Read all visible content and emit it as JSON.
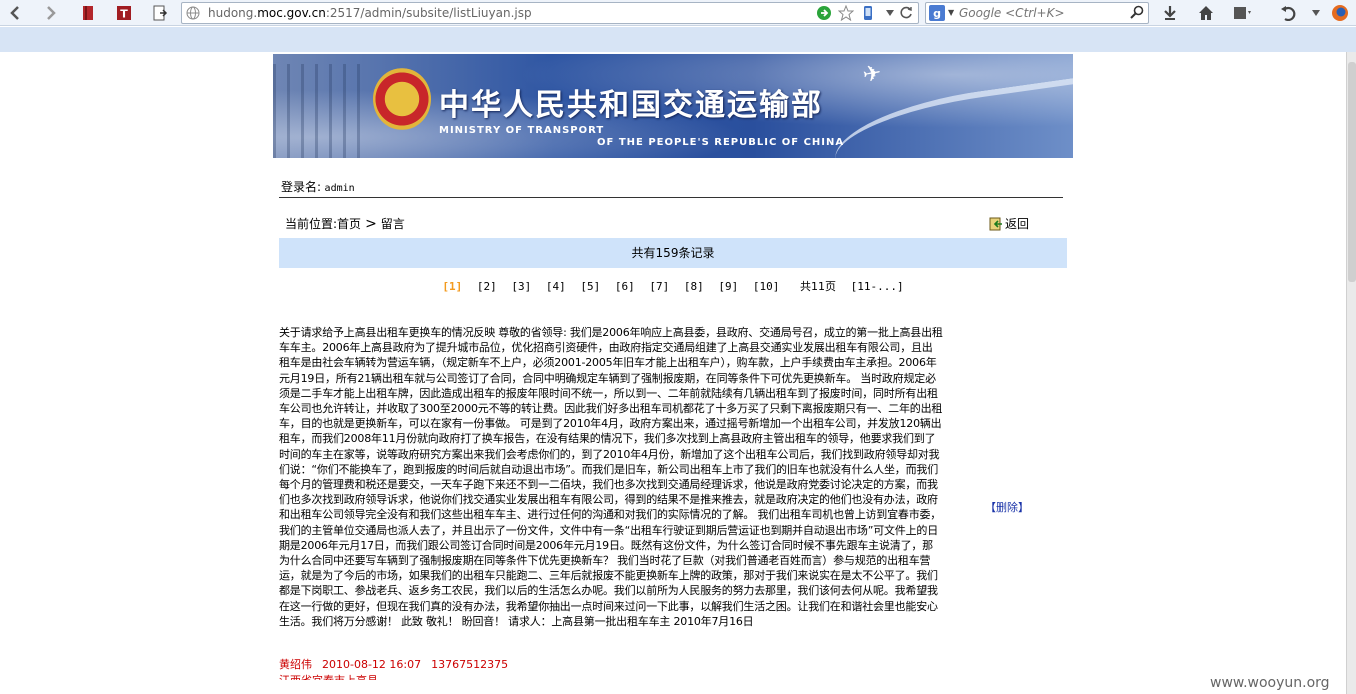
{
  "browser": {
    "url_prefix": "hudong.",
    "url_domain": "moc.gov.cn",
    "url_suffix": ":2517/admin/subsite/listLiuyan.jsp",
    "search_placeholder": "Google <Ctrl+K>",
    "search_engine": "google-icon"
  },
  "banner": {
    "title_cn": "中华人民共和国交通运输部",
    "title_en_line1": "MINISTRY OF TRANSPORT",
    "title_en_line2": "OF THE PEOPLE'S REPUBLIC OF CHINA"
  },
  "login": {
    "label": "登录名:",
    "user": "admin"
  },
  "breadcrumb": {
    "label": "当前位置:",
    "home": "首页",
    "separator": ">",
    "current": "留言"
  },
  "back_label": "返回",
  "records_text": "共有159条记录",
  "pager": {
    "pages": [
      "[1]",
      "[2]",
      "[3]",
      "[4]",
      "[5]",
      "[6]",
      "[7]",
      "[8]",
      "[9]",
      "[10]"
    ],
    "current_page": "[1]",
    "total": "共11页",
    "next": "[11-...]"
  },
  "message": {
    "body": "关于请求给予上高县出租车更换车的情况反映 尊敬的省领导: 我们是2006年响应上高县委，县政府、交通局号召，成立的第一批上高县出租车车主。2006年上高县政府为了提升城市品位，优化招商引资硬件，由政府指定交通局组建了上高县交通实业发展出租车有限公司，且出租车是由社会车辆转为营运车辆，（规定新车不上户，必须2001-2005年旧车才能上出租车户），购车款，上户手续费由车主承担。2006年元月19日，所有21辆出租车就与公司签订了合同，合同中明确规定车辆到了强制报废期，在同等条件下可优先更换新车。 当时政府规定必须是二手车才能上出租车牌，因此造成出租车的报废年限时间不统一，所以到一、二年前就陆续有几辆出租车到了报废时间，同时所有出租车公司也允许转让，并收取了300至2000元不等的转让费。因此我们好多出租车司机都花了十多万买了只剩下离报废期只有一、二年的出租车，目的也就是更换新车，可以在家有一份事做。 可是到了2010年4月，政府方案出来，通过摇号新增加一个出租车公司，并发放120辆出租车，而我们2008年11月份就向政府打了换车报告，在没有结果的情况下，我们多次找到上高县政府主管出租车的领导，他要求我们到了时间的车主在家等，说等政府研究方案出来我们会考虑你们的，到了2010年4月份，新增加了这个出租车公司后，我们找到政府领导却对我们说：“你们不能换车了，跑到报废的时间后就自动退出市场”。而我们是旧车，新公司出租车上市了我们的旧车也就没有什么人坐，而我们每个月的管理费和税还是要交，一天车子跑下来还不到一二佰块，我们也多次找到交通局经理诉求，他说是政府党委讨论决定的方案，而我们也多次找到政府领导诉求，他说你们找交通实业发展出租车有限公司，得到的结果不是推来推去，就是政府决定的他们也没有办法，政府和出租车公司领导完全没有和我们这些出租车车主、进行过任何的沟通和对我们的实际情况的了解。 我们出租车司机也曾上访到宜春市委，我们的主管单位交通局也派人去了，并且出示了一份文件，文件中有一条“出租车行驶证到期后营运证也到期并自动退出市场”可文件上的日期是2006年元月17日，而我们跟公司签订合同时间是2006年元月19日。既然有这份文件，为什么签订合同时候不事先跟车主说清了，那为什么合同中还要写车辆到了强制报废期在同等条件下优先更换新车？ 我们当时花了巨款（对我们普通老百姓而言）参与规范的出租车营运，就是为了今后的市场，如果我们的出租车只能跑二、三年后就报废不能更换新车上牌的政策，那对于我们来说实在是太不公平了。我们都是下岗职工、参战老兵、返乡务工农民，我们以后的生活怎么办呢。我们以前所为人民服务的努力去那里，我们该何去何从呢。我希望我在这一行做的更好，但现在我们真的没有办法，我希望你抽出一点时间来过问一下此事，以解我们生活之困。让我们在和谐社会里也能安心生活。我们将万分感谢！ 此致 敬礼！ 盼回音！ 请求人：上高县第一批出租车车主 2010年7月16日",
    "author": "黄绍伟",
    "datetime": "2010-08-12 16:07",
    "phone": "13767512375",
    "next_author_partial": "江西省宜春市上高县",
    "delete_label": "【删除】"
  },
  "watermark": "www.wooyun.org",
  "colors": {
    "records_bg": "#cfe3fa",
    "current_page": "#f39a1e",
    "meta_red": "#cc0000",
    "delete_blue": "#1a33a8"
  }
}
